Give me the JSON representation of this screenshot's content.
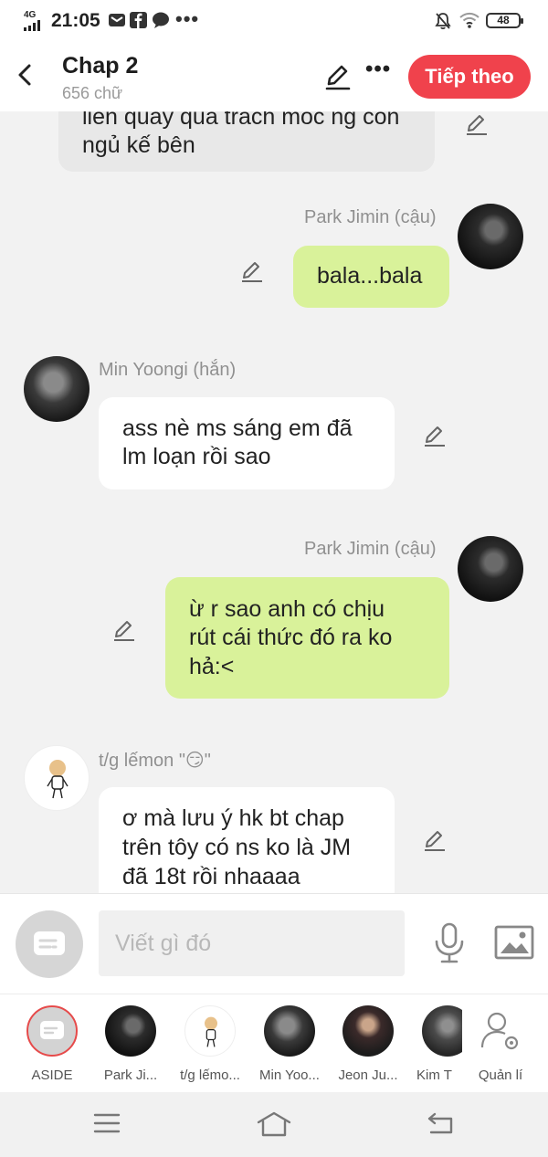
{
  "status_bar": {
    "network": "4G",
    "time": "21:05",
    "battery": "48",
    "overflow": "•••"
  },
  "header": {
    "title": "Chap 2",
    "word_count": "656 chữ",
    "more": "•••",
    "next_label": "Tiếp theo"
  },
  "chat": {
    "messages": [
      {
        "side": "left",
        "text_lines": [
          "liền quay qua trách móc ng còn",
          "ngủ kế bên"
        ]
      },
      {
        "side": "right",
        "sender": "Park Jimin (cậu)",
        "text_lines": [
          "bala...bala"
        ]
      },
      {
        "side": "left",
        "sender": "Min Yoongi (hắn)",
        "text_lines": [
          "ass nè ms sáng em đã",
          "lm loạn rồi sao"
        ]
      },
      {
        "side": "right",
        "sender": "Park Jimin (cậu)",
        "text_lines": [
          "ừ r sao anh có chịu",
          "rút cái thức đó ra ko",
          "hả:<"
        ]
      },
      {
        "side": "left",
        "sender": "t/g lếmon \"😏\"",
        "text_lines": [
          "ơ mà lưu ý hk bt chap",
          "trên tôy có ns ko là JM",
          "đã 18t rồi nhaaaa"
        ]
      }
    ]
  },
  "input": {
    "placeholder": "Viết gì đó"
  },
  "characters": [
    {
      "label": "ASIDE"
    },
    {
      "label": "Park Ji..."
    },
    {
      "label": "t/g lếmo..."
    },
    {
      "label": "Min Yoo..."
    },
    {
      "label": "Jeon Ju..."
    },
    {
      "label": "Kim T"
    },
    {
      "label": "Quản lí"
    }
  ],
  "colors": {
    "accent": "#f0424c",
    "bubble_self": "#d9f29a",
    "bubble_other": "#ffffff",
    "background": "#f2f2f2"
  }
}
